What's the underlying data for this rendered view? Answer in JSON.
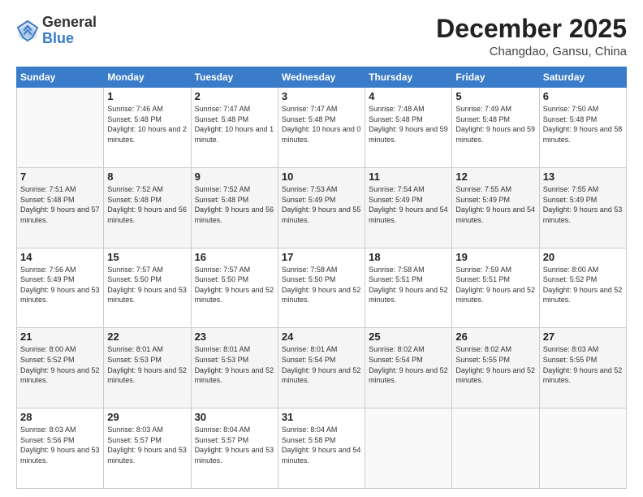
{
  "header": {
    "logo_general": "General",
    "logo_blue": "Blue",
    "month_title": "December 2025",
    "location": "Changdao, Gansu, China"
  },
  "days_of_week": [
    "Sunday",
    "Monday",
    "Tuesday",
    "Wednesday",
    "Thursday",
    "Friday",
    "Saturday"
  ],
  "weeks": [
    [
      {
        "day": "",
        "sunrise": "",
        "sunset": "",
        "daylight": ""
      },
      {
        "day": "1",
        "sunrise": "Sunrise: 7:46 AM",
        "sunset": "Sunset: 5:48 PM",
        "daylight": "Daylight: 10 hours and 2 minutes."
      },
      {
        "day": "2",
        "sunrise": "Sunrise: 7:47 AM",
        "sunset": "Sunset: 5:48 PM",
        "daylight": "Daylight: 10 hours and 1 minute."
      },
      {
        "day": "3",
        "sunrise": "Sunrise: 7:47 AM",
        "sunset": "Sunset: 5:48 PM",
        "daylight": "Daylight: 10 hours and 0 minutes."
      },
      {
        "day": "4",
        "sunrise": "Sunrise: 7:48 AM",
        "sunset": "Sunset: 5:48 PM",
        "daylight": "Daylight: 9 hours and 59 minutes."
      },
      {
        "day": "5",
        "sunrise": "Sunrise: 7:49 AM",
        "sunset": "Sunset: 5:48 PM",
        "daylight": "Daylight: 9 hours and 59 minutes."
      },
      {
        "day": "6",
        "sunrise": "Sunrise: 7:50 AM",
        "sunset": "Sunset: 5:48 PM",
        "daylight": "Daylight: 9 hours and 58 minutes."
      }
    ],
    [
      {
        "day": "7",
        "sunrise": "Sunrise: 7:51 AM",
        "sunset": "Sunset: 5:48 PM",
        "daylight": "Daylight: 9 hours and 57 minutes."
      },
      {
        "day": "8",
        "sunrise": "Sunrise: 7:52 AM",
        "sunset": "Sunset: 5:48 PM",
        "daylight": "Daylight: 9 hours and 56 minutes."
      },
      {
        "day": "9",
        "sunrise": "Sunrise: 7:52 AM",
        "sunset": "Sunset: 5:48 PM",
        "daylight": "Daylight: 9 hours and 56 minutes."
      },
      {
        "day": "10",
        "sunrise": "Sunrise: 7:53 AM",
        "sunset": "Sunset: 5:49 PM",
        "daylight": "Daylight: 9 hours and 55 minutes."
      },
      {
        "day": "11",
        "sunrise": "Sunrise: 7:54 AM",
        "sunset": "Sunset: 5:49 PM",
        "daylight": "Daylight: 9 hours and 54 minutes."
      },
      {
        "day": "12",
        "sunrise": "Sunrise: 7:55 AM",
        "sunset": "Sunset: 5:49 PM",
        "daylight": "Daylight: 9 hours and 54 minutes."
      },
      {
        "day": "13",
        "sunrise": "Sunrise: 7:55 AM",
        "sunset": "Sunset: 5:49 PM",
        "daylight": "Daylight: 9 hours and 53 minutes."
      }
    ],
    [
      {
        "day": "14",
        "sunrise": "Sunrise: 7:56 AM",
        "sunset": "Sunset: 5:49 PM",
        "daylight": "Daylight: 9 hours and 53 minutes."
      },
      {
        "day": "15",
        "sunrise": "Sunrise: 7:57 AM",
        "sunset": "Sunset: 5:50 PM",
        "daylight": "Daylight: 9 hours and 53 minutes."
      },
      {
        "day": "16",
        "sunrise": "Sunrise: 7:57 AM",
        "sunset": "Sunset: 5:50 PM",
        "daylight": "Daylight: 9 hours and 52 minutes."
      },
      {
        "day": "17",
        "sunrise": "Sunrise: 7:58 AM",
        "sunset": "Sunset: 5:50 PM",
        "daylight": "Daylight: 9 hours and 52 minutes."
      },
      {
        "day": "18",
        "sunrise": "Sunrise: 7:58 AM",
        "sunset": "Sunset: 5:51 PM",
        "daylight": "Daylight: 9 hours and 52 minutes."
      },
      {
        "day": "19",
        "sunrise": "Sunrise: 7:59 AM",
        "sunset": "Sunset: 5:51 PM",
        "daylight": "Daylight: 9 hours and 52 minutes."
      },
      {
        "day": "20",
        "sunrise": "Sunrise: 8:00 AM",
        "sunset": "Sunset: 5:52 PM",
        "daylight": "Daylight: 9 hours and 52 minutes."
      }
    ],
    [
      {
        "day": "21",
        "sunrise": "Sunrise: 8:00 AM",
        "sunset": "Sunset: 5:52 PM",
        "daylight": "Daylight: 9 hours and 52 minutes."
      },
      {
        "day": "22",
        "sunrise": "Sunrise: 8:01 AM",
        "sunset": "Sunset: 5:53 PM",
        "daylight": "Daylight: 9 hours and 52 minutes."
      },
      {
        "day": "23",
        "sunrise": "Sunrise: 8:01 AM",
        "sunset": "Sunset: 5:53 PM",
        "daylight": "Daylight: 9 hours and 52 minutes."
      },
      {
        "day": "24",
        "sunrise": "Sunrise: 8:01 AM",
        "sunset": "Sunset: 5:54 PM",
        "daylight": "Daylight: 9 hours and 52 minutes."
      },
      {
        "day": "25",
        "sunrise": "Sunrise: 8:02 AM",
        "sunset": "Sunset: 5:54 PM",
        "daylight": "Daylight: 9 hours and 52 minutes."
      },
      {
        "day": "26",
        "sunrise": "Sunrise: 8:02 AM",
        "sunset": "Sunset: 5:55 PM",
        "daylight": "Daylight: 9 hours and 52 minutes."
      },
      {
        "day": "27",
        "sunrise": "Sunrise: 8:03 AM",
        "sunset": "Sunset: 5:55 PM",
        "daylight": "Daylight: 9 hours and 52 minutes."
      }
    ],
    [
      {
        "day": "28",
        "sunrise": "Sunrise: 8:03 AM",
        "sunset": "Sunset: 5:56 PM",
        "daylight": "Daylight: 9 hours and 53 minutes."
      },
      {
        "day": "29",
        "sunrise": "Sunrise: 8:03 AM",
        "sunset": "Sunset: 5:57 PM",
        "daylight": "Daylight: 9 hours and 53 minutes."
      },
      {
        "day": "30",
        "sunrise": "Sunrise: 8:04 AM",
        "sunset": "Sunset: 5:57 PM",
        "daylight": "Daylight: 9 hours and 53 minutes."
      },
      {
        "day": "31",
        "sunrise": "Sunrise: 8:04 AM",
        "sunset": "Sunset: 5:58 PM",
        "daylight": "Daylight: 9 hours and 54 minutes."
      },
      {
        "day": "",
        "sunrise": "",
        "sunset": "",
        "daylight": ""
      },
      {
        "day": "",
        "sunrise": "",
        "sunset": "",
        "daylight": ""
      },
      {
        "day": "",
        "sunrise": "",
        "sunset": "",
        "daylight": ""
      }
    ]
  ]
}
